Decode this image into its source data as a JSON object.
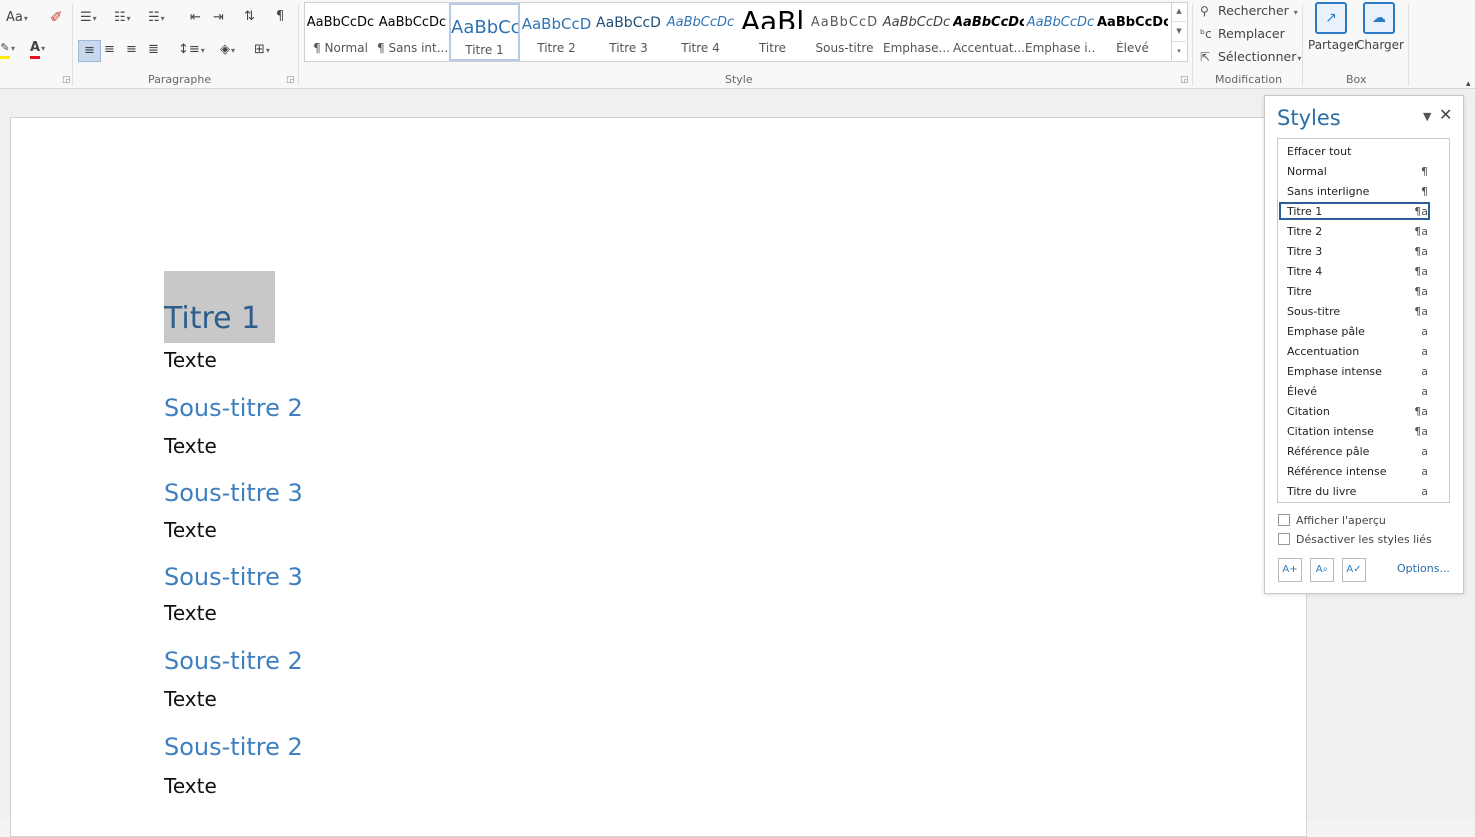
{
  "ribbon": {
    "font_group": {
      "case_button": "Aa",
      "clear_format_icon": "eraser-icon",
      "highlight_icon": "highlighter-icon",
      "font_color_label": "A",
      "colors": {
        "highlight": "#ffee00",
        "font_color": "#e81123"
      }
    },
    "paragraph": {
      "label": "Paragraphe",
      "show_marks": "¶"
    },
    "styles_gallery": {
      "label": "Style",
      "items": [
        {
          "sample": "AaBbCcDc",
          "name": "¶ Normal",
          "color": "#000000"
        },
        {
          "sample": "AaBbCcDc",
          "name": "¶ Sans int...",
          "color": "#000000"
        },
        {
          "sample": "AaBbCc",
          "name": "Titre 1",
          "color": "#2e74b5",
          "selected": true
        },
        {
          "sample": "AaBbCcD",
          "name": "Titre 2",
          "color": "#2e74b5"
        },
        {
          "sample": "AaBbCcD",
          "name": "Titre 3",
          "color": "#1f4d78"
        },
        {
          "sample": "AaBbCcDc",
          "name": "Titre 4",
          "color": "#2e74b5"
        },
        {
          "sample": "AaBl",
          "name": "Titre",
          "color": "#000000"
        },
        {
          "sample": "AaBbCcD",
          "name": "Sous-titre",
          "color": "#5a5a5a"
        },
        {
          "sample": "AaBbCcDc",
          "name": "Emphase...",
          "color": "#404040"
        },
        {
          "sample": "AaBbCcDc",
          "name": "Accentuat...",
          "color": "#000000"
        },
        {
          "sample": "AaBbCcDc",
          "name": "Emphase i...",
          "color": "#2e74b5"
        },
        {
          "sample": "AaBbCcDc",
          "name": "Élevé",
          "color": "#000000"
        }
      ]
    },
    "editing": {
      "label": "Modification",
      "find": "Rechercher",
      "replace": "Remplacer",
      "select": "Sélectionner"
    },
    "box": {
      "label": "Box",
      "share": "Partager",
      "upload": "Charger"
    }
  },
  "document": {
    "lines": [
      {
        "text": "Titre 1",
        "style": "h1"
      },
      {
        "text": "Texte",
        "style": "txt"
      },
      {
        "text": "Sous-titre 2",
        "style": "h2"
      },
      {
        "text": "Texte",
        "style": "txt"
      },
      {
        "text": "Sous-titre 3",
        "style": "h2"
      },
      {
        "text": "Texte",
        "style": "txt"
      },
      {
        "text": "Sous-titre 3",
        "style": "h2"
      },
      {
        "text": "Texte",
        "style": "txt"
      },
      {
        "text": "Sous-titre 2",
        "style": "h2"
      },
      {
        "text": "Texte",
        "style": "txt"
      },
      {
        "text": "Sous-titre 2",
        "style": "h2"
      },
      {
        "text": "Texte",
        "style": "txt"
      }
    ]
  },
  "styles_pane": {
    "title": "Styles",
    "items": [
      {
        "name": "Effacer tout",
        "icon": ""
      },
      {
        "name": "Normal",
        "icon": "¶"
      },
      {
        "name": "Sans interligne",
        "icon": "¶"
      },
      {
        "name": "Titre 1",
        "icon": "¶a",
        "selected": true
      },
      {
        "name": "Titre 2",
        "icon": "¶a"
      },
      {
        "name": "Titre 3",
        "icon": "¶a"
      },
      {
        "name": "Titre 4",
        "icon": "¶a"
      },
      {
        "name": "Titre",
        "icon": "¶a"
      },
      {
        "name": "Sous-titre",
        "icon": "¶a"
      },
      {
        "name": "Emphase pâle",
        "icon": "a"
      },
      {
        "name": "Accentuation",
        "icon": "a"
      },
      {
        "name": "Emphase intense",
        "icon": "a"
      },
      {
        "name": "Élevé",
        "icon": "a"
      },
      {
        "name": "Citation",
        "icon": "¶a"
      },
      {
        "name": "Citation intense",
        "icon": "¶a"
      },
      {
        "name": "Référence pâle",
        "icon": "a"
      },
      {
        "name": "Référence intense",
        "icon": "a"
      },
      {
        "name": "Titre du livre",
        "icon": "a"
      }
    ],
    "show_preview": "Afficher l'aperçu",
    "disable_linked": "Désactiver les styles liés",
    "options": "Options..."
  }
}
